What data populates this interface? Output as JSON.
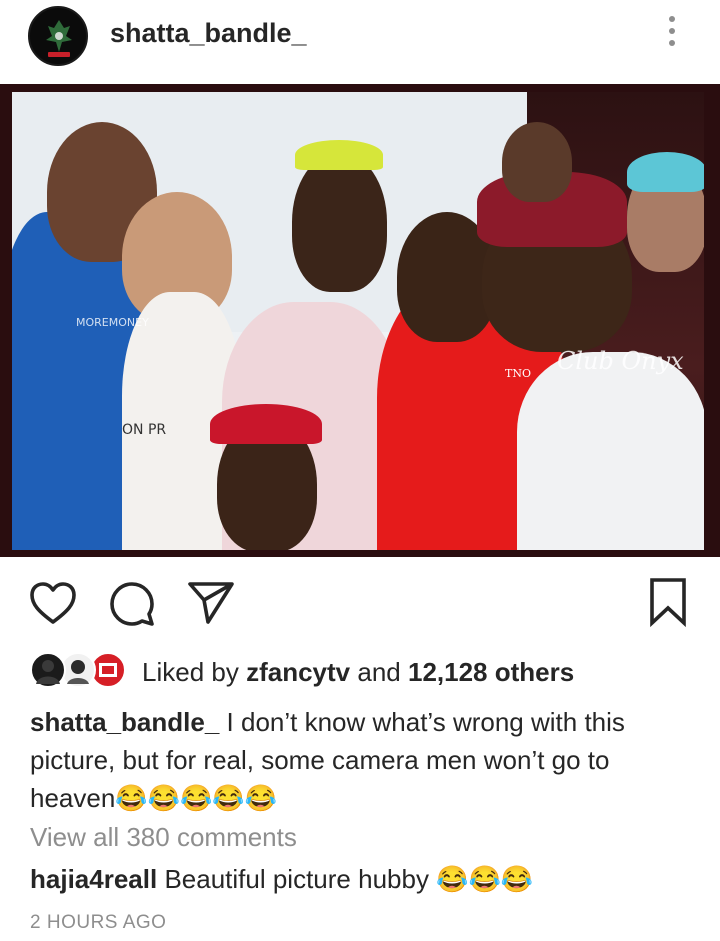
{
  "post": {
    "username": "shatta_bandle_",
    "more_icon": "more-vertical-icon",
    "photo_watermarks": [
      "MOREMONEY",
      "TNO",
      "Club Onyx",
      "ON PR"
    ]
  },
  "actions": {
    "like_icon": "heart-icon",
    "comment_icon": "comment-icon",
    "share_icon": "send-icon",
    "save_icon": "bookmark-icon"
  },
  "likes": {
    "prefix": "Liked by",
    "first_user": "zfancytv",
    "middle": "and",
    "others": "12,128 others"
  },
  "caption": {
    "username": "shatta_bandle_",
    "text": "I don’t know what’s wrong with this picture, but for real, some camera men won’t go to heaven😂😂😂😂😂"
  },
  "comments": {
    "view_all": "View all 380 comments",
    "items": [
      {
        "username": "hajia4reall",
        "text": "Beautiful picture hubby 😂😂😂"
      }
    ]
  },
  "timestamp": "2 HOURS AGO"
}
